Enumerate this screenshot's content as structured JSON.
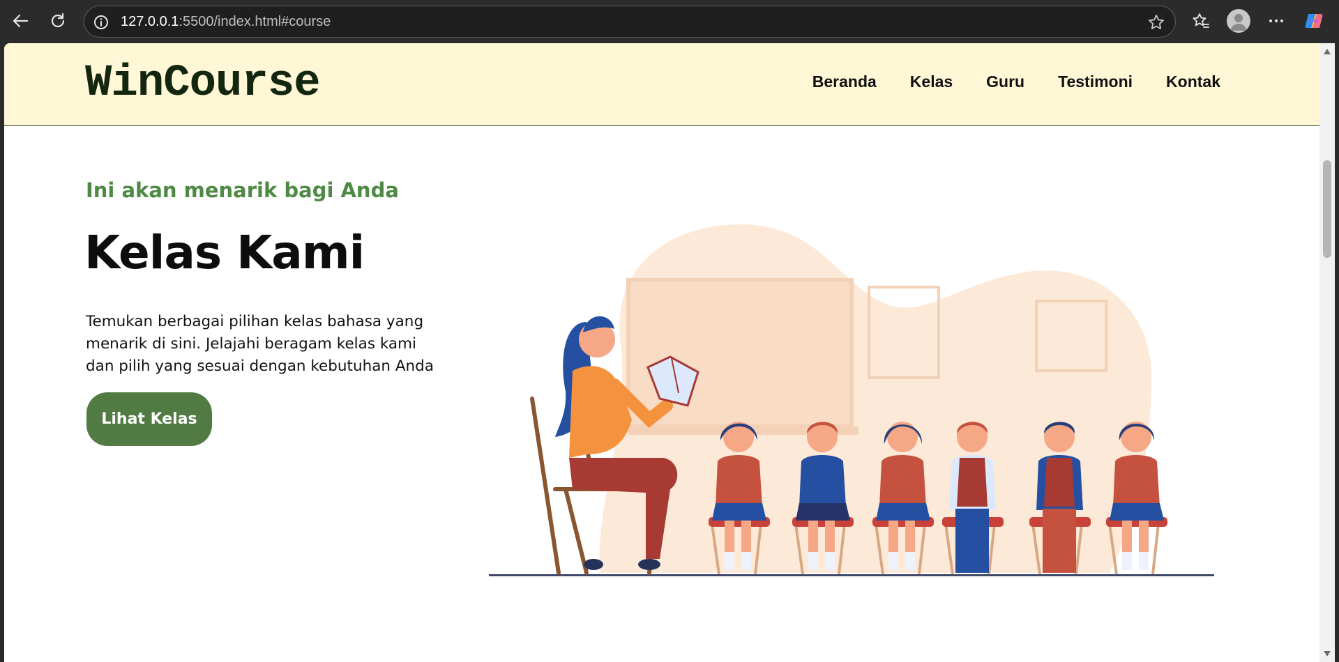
{
  "browser": {
    "url_host": "127.0.0.1",
    "url_rest": ":5500/index.html#course"
  },
  "site": {
    "logo": "WinCourse",
    "nav": [
      "Beranda",
      "Kelas",
      "Guru",
      "Testimoni",
      "Kontak"
    ]
  },
  "hero": {
    "eyebrow": "Ini akan menarik bagi Anda",
    "title": "Kelas Kami",
    "description": "Temukan berbagai pilihan kelas bahasa yang menarik di sini. Jelajahi beragam kelas kami dan pilih yang sesuai dengan kebutuhan Anda",
    "button_label": "Lihat Kelas"
  },
  "colors": {
    "header_bg": "#fff7d6",
    "accent_green": "#517b43",
    "eyebrow_green": "#4f8a45",
    "logo_dark": "#13260f"
  }
}
